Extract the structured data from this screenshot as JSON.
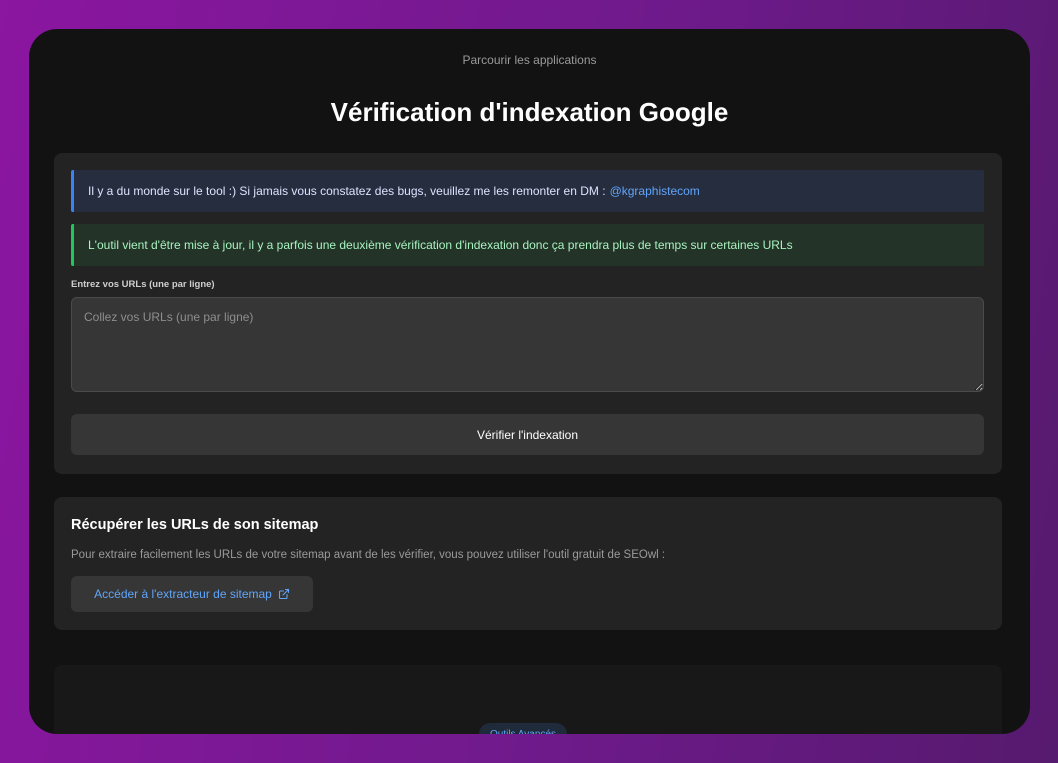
{
  "header": {
    "browse_link": "Parcourir les applications",
    "title": "Vérification d'indexation Google"
  },
  "alerts": {
    "info_text": "Il y a du monde sur le tool :) Si jamais vous constatez des bugs, veuillez me les remonter en DM :",
    "info_handle": "@kgraphistecom",
    "success_text": "L'outil vient d'être mise à jour, il y a parfois une deuxième vérification d'indexation donc ça prendra plus de temps sur certaines URLs"
  },
  "form": {
    "label": "Entrez vos URLs (une par ligne)",
    "placeholder": "Collez vos URLs (une par ligne)",
    "value": "",
    "verify_label": "Vérifier l'indexation"
  },
  "sitemap": {
    "title": "Récupérer les URLs de son sitemap",
    "description": "Pour extraire facilement les URLs de votre sitemap avant de les vérifier, vous pouvez utiliser l'outil gratuit de SEOwl :",
    "link_label": "Accéder à l'extracteur de sitemap",
    "link_icon": "external-link-icon"
  },
  "footer": {
    "badge": "Outils Avancés"
  },
  "colors": {
    "accent_blue": "#60a5fa",
    "info_border": "#3b82f6",
    "success_border": "#22c55e",
    "background_gradient_start": "#8b16a0",
    "background_gradient_end": "#561a6e"
  }
}
